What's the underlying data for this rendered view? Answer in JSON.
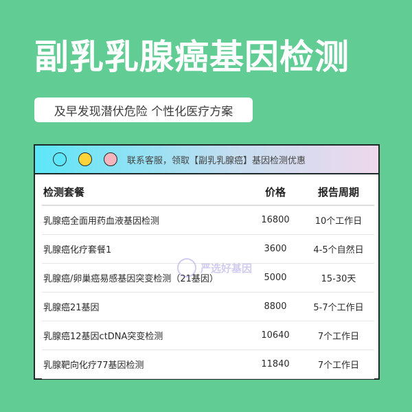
{
  "header": {
    "title": "副乳乳腺癌基因检测",
    "subtitle": "及早发现潜伏危险 个性化医疗方案"
  },
  "window": {
    "bar_text": "联系客服，领取【副乳乳腺癌】基因检测优惠",
    "dot_colors": [
      "#5ce6f7",
      "#ffd43b",
      "#f6b4bd"
    ]
  },
  "table": {
    "headers": [
      "检测套餐",
      "价格",
      "报告周期"
    ],
    "rows": [
      [
        "乳腺癌全面用药血液基因检测",
        "16800",
        "10个工作日"
      ],
      [
        "乳腺癌化疗套餐1",
        "3600",
        "4-5个自然日"
      ],
      [
        "乳腺癌/卵巢癌易感基因突变检测（21基因）",
        "5000",
        "15-30天"
      ],
      [
        "乳腺癌21基因",
        "8800",
        "5-7个工作日"
      ],
      [
        "乳腺癌12基因ctDNA突变检测",
        "10640",
        "7个工作日"
      ],
      [
        "乳腺靶向化疗77基因检测",
        "11840",
        "7个工作日"
      ]
    ]
  },
  "watermark": {
    "text": "严选好基因"
  }
}
